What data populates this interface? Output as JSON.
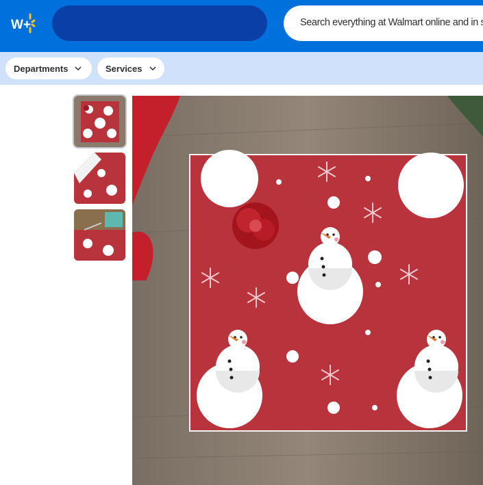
{
  "header": {
    "logo_text": "W+",
    "search_placeholder": "Search everything at Walmart online and in store"
  },
  "nav": {
    "departments": "Departments",
    "services": "Services"
  },
  "product": {
    "thumbnails": [
      "thumbnail-1",
      "thumbnail-2",
      "thumbnail-3"
    ],
    "selected_thumbnail": 1
  },
  "colors": {
    "brand_blue": "#0071dc",
    "spark_yellow": "#ffc220",
    "paper_red": "#b8333b"
  }
}
